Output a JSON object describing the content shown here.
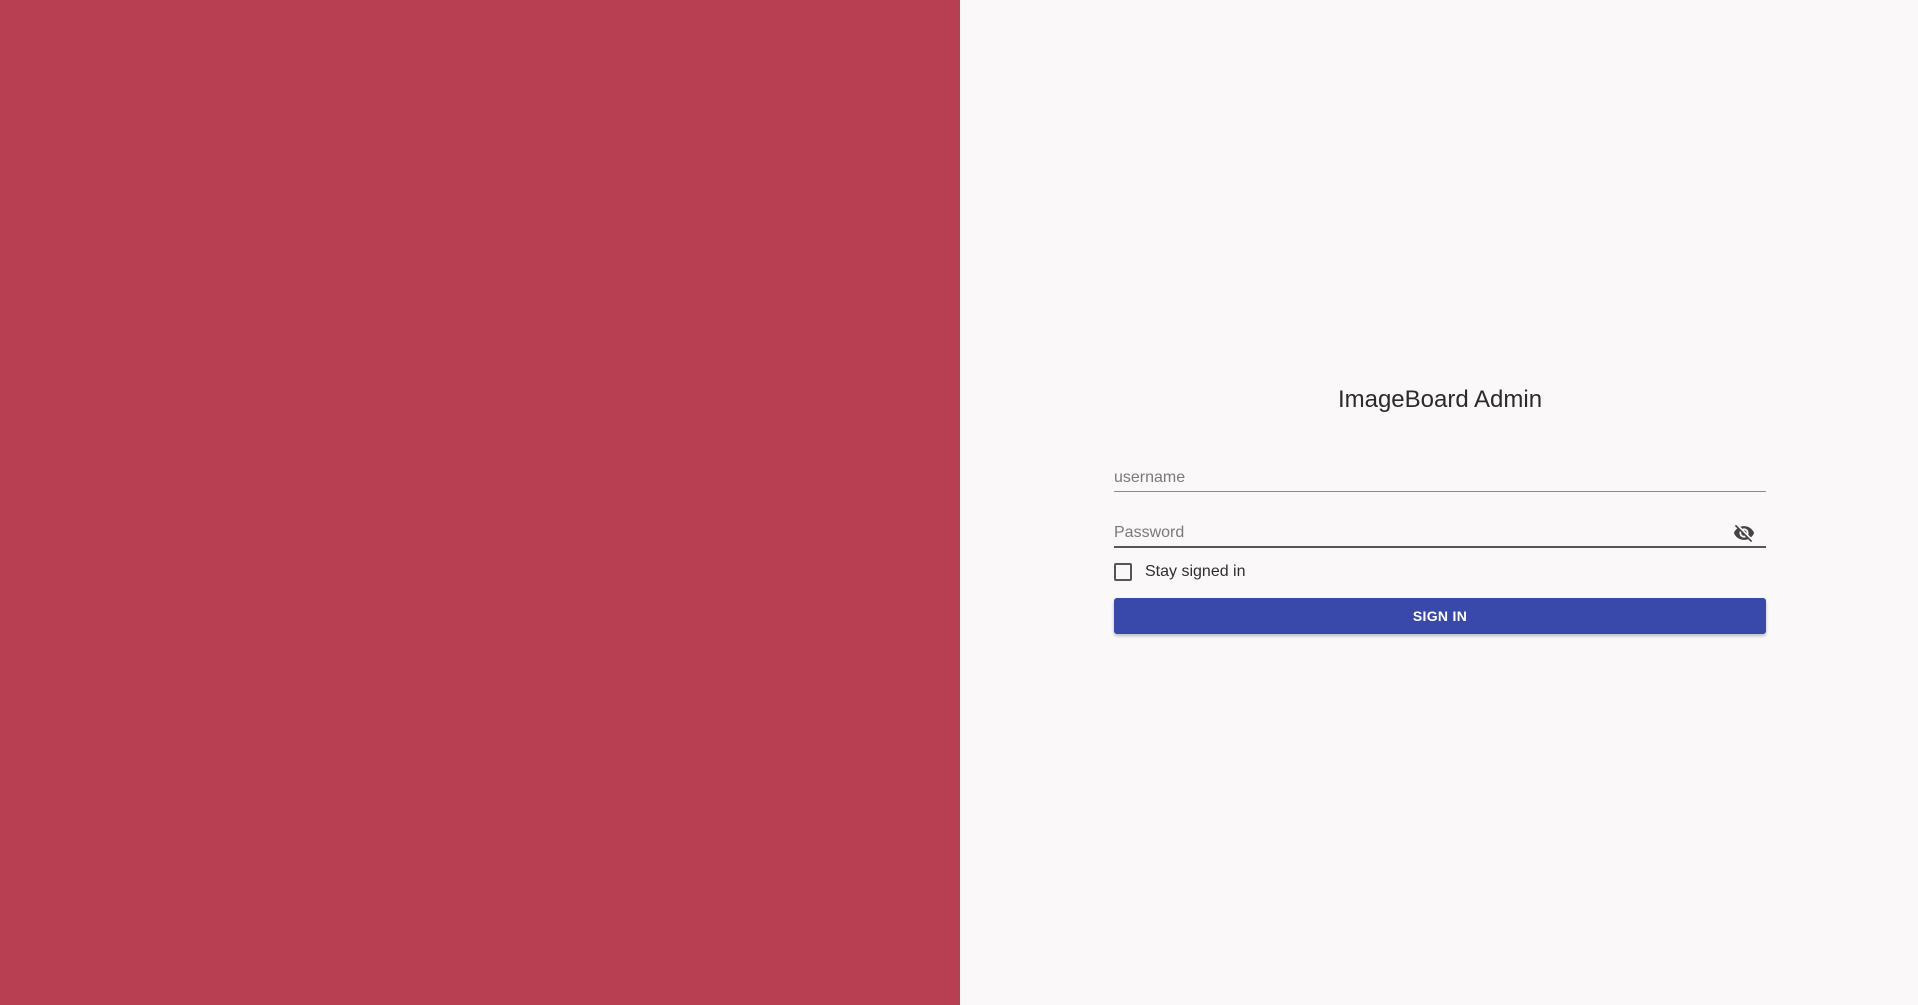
{
  "app": {
    "title": "ImageBoard Admin"
  },
  "colors": {
    "left_panel": "#b83f51",
    "right_panel": "#faf8f8",
    "primary_button": "#3949ab"
  },
  "form": {
    "username": {
      "placeholder": "username",
      "value": ""
    },
    "password": {
      "placeholder": "Password",
      "value": "",
      "toggle_icon": "visibility-off-icon"
    },
    "stay_signed_in": {
      "label": "Stay signed in",
      "checked": false
    },
    "submit_label": "SIGN IN"
  }
}
